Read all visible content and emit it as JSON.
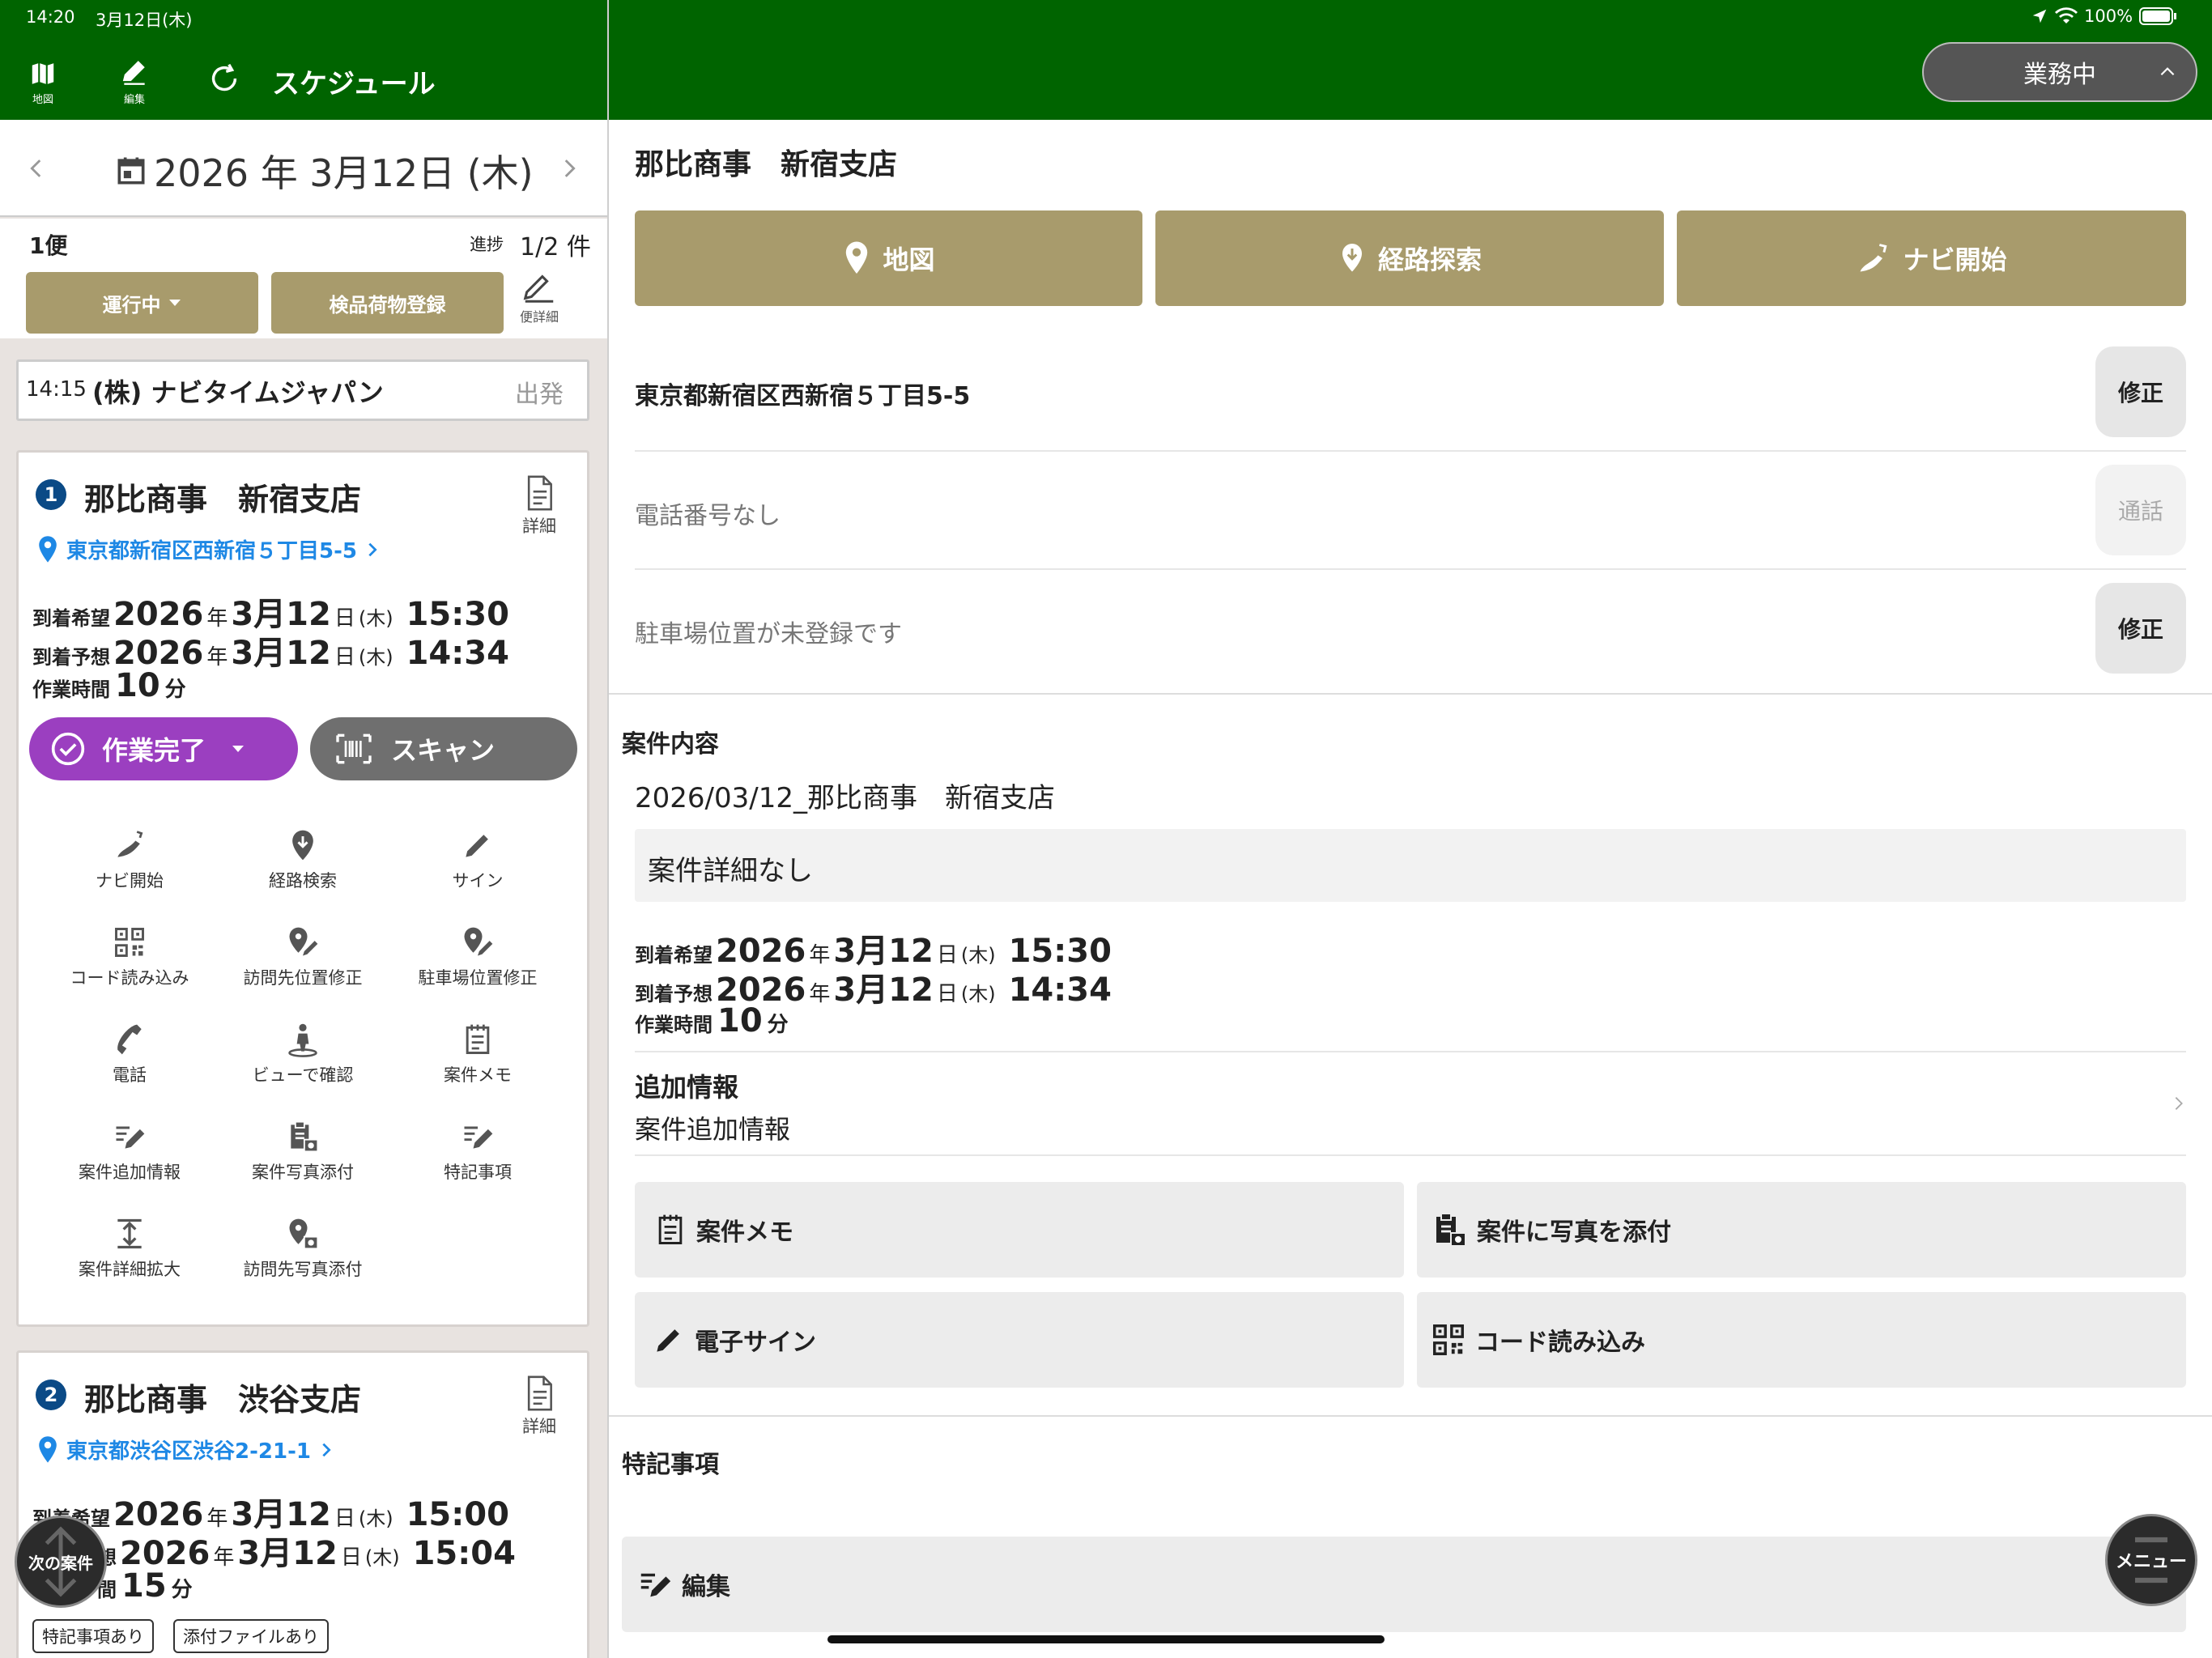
{
  "status_bar": {
    "time": "14:20",
    "date": "3月12日(木)",
    "battery": "100%"
  },
  "header": {
    "icons": [
      {
        "label": "地図",
        "icon": "map-icon"
      },
      {
        "label": "編集",
        "icon": "pencil-icon"
      }
    ],
    "title": "スケジュール",
    "status_button": "業務中"
  },
  "date_nav": {
    "date": "2026 年 3月12日 (木)"
  },
  "trip": {
    "name": "1便",
    "progress_label": "進捗",
    "progress_value": "1/2 件",
    "status_button": "運行中",
    "register_button": "検品荷物登録",
    "detail_label": "便詳細"
  },
  "departure": {
    "time": "14:15",
    "name": "(株) ナビタイムジャパン",
    "label": "出発"
  },
  "stops": [
    {
      "number": "1",
      "name": "那比商事　新宿支店",
      "address": "東京都新宿区西新宿５丁目5-5",
      "detail_label": "詳細",
      "arrival_wish_label": "到着希望",
      "arrival_wish": {
        "year": "2026",
        "y": "年",
        "md": "3月12",
        "d": "日",
        "dow": "(木)",
        "time": "15:30"
      },
      "arrival_est_label": "到着予想",
      "arrival_est": {
        "year": "2026",
        "y": "年",
        "md": "3月12",
        "d": "日",
        "dow": "(木)",
        "time": "14:34"
      },
      "work_label": "作業時間",
      "work_value": "10",
      "work_unit": "分",
      "complete_button": "作業完了",
      "scan_button": "スキャン",
      "actions": [
        "ナビ開始",
        "経路検索",
        "サイン",
        "コード読み込み",
        "訪問先位置修正",
        "駐車場位置修正",
        "電話",
        "ビューで確認",
        "案件メモ",
        "案件追加情報",
        "案件写真添付",
        "特記事項",
        "案件詳細拡大",
        "訪問先写真添付"
      ]
    },
    {
      "number": "2",
      "name": "那比商事　渋谷支店",
      "address": "東京都渋谷区渋谷2-21-1",
      "detail_label": "詳細",
      "arrival_wish_label": "到着希望",
      "arrival_wish": {
        "year": "2026",
        "y": "年",
        "md": "3月12",
        "d": "日",
        "dow": "(木)",
        "time": "15:00"
      },
      "arrival_est_label": "想",
      "arrival_est": {
        "year": "2026",
        "y": "年",
        "md": "3月12",
        "d": "日",
        "dow": "(木)",
        "time": "15:04"
      },
      "work_label": "間",
      "work_value": "15",
      "work_unit": "分",
      "tags": [
        "特記事項あり",
        "添付ファイルあり"
      ]
    }
  ],
  "next_case_button": "次の案件",
  "detail": {
    "title": "那比商事　新宿支店",
    "map_button": "地図",
    "route_button": "経路探索",
    "navi_button": "ナビ開始",
    "address": "東京都新宿区西新宿５丁目5-5",
    "edit_label": "修正",
    "phone": "電話番号なし",
    "call_label": "通話",
    "parking": "駐車場位置が未登録です",
    "case_section": "案件内容",
    "case_name": "2026/03/12_那比商事　新宿支店",
    "case_detail": "案件詳細なし",
    "extra_title": "追加情報",
    "extra_value": "案件追加情報",
    "memo_button": "案件メモ",
    "photo_button": "案件に写真を添付",
    "sign_button": "電子サイン",
    "code_button": "コード読み込み",
    "notes_section": "特記事項",
    "notes_edit": "編集",
    "menu_button": "メニュー"
  },
  "colors": {
    "header": "#006400",
    "gold": "#a89b6c",
    "purple": "#9b3fc0",
    "link": "#1e88e5"
  }
}
